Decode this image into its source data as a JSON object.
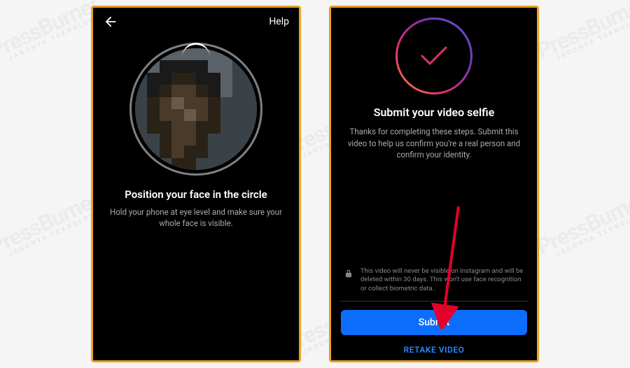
{
  "watermark": {
    "brand": "PressBurner",
    "tagline": "JAGONYA TEKNOLOGI"
  },
  "screen1": {
    "help_label": "Help",
    "title": "Position your face in the circle",
    "subtitle": "Hold your phone at eye level and make sure your whole face is visible."
  },
  "screen2": {
    "title": "Submit your video selfie",
    "subtitle": "Thanks for completing these steps. Submit this video to help us confirm you're a real person and confirm your identity.",
    "privacy_text": "This video will never be visible on Instagram and will be deleted within 30 days. This won't use face recognition or collect biometric data.",
    "submit_label": "Submit",
    "retake_label": "RETAKE VIDEO"
  }
}
